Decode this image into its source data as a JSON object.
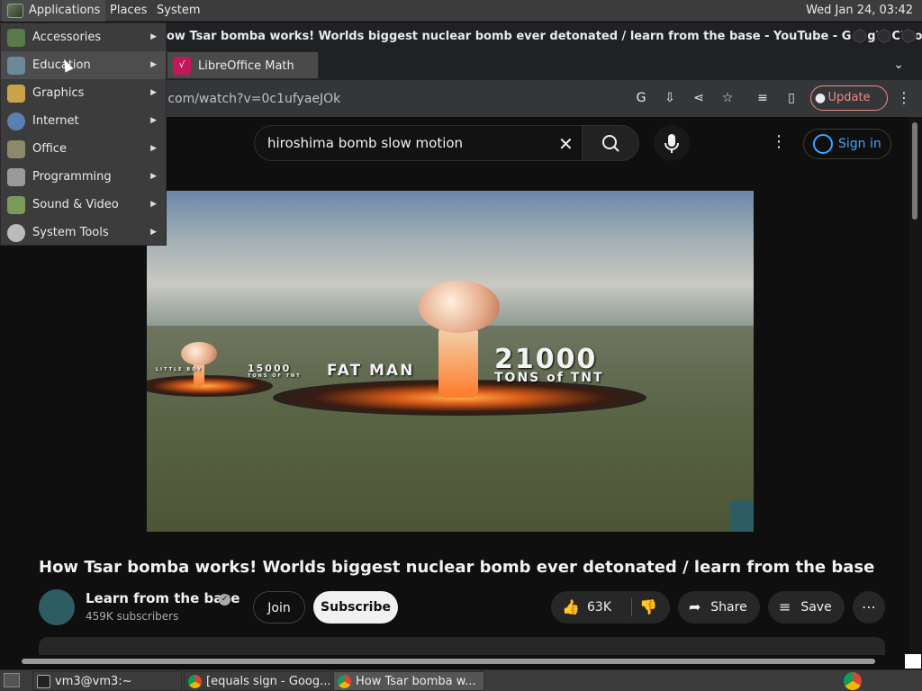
{
  "top_panel": {
    "applications": "Applications",
    "places": "Places",
    "system": "System",
    "clock": "Wed Jan 24, 03:42"
  },
  "apps_menu": {
    "items": [
      {
        "label": "Accessories",
        "icon": "accessories-icon"
      },
      {
        "label": "Education",
        "icon": "education-icon"
      },
      {
        "label": "Graphics",
        "icon": "graphics-icon"
      },
      {
        "label": "Internet",
        "icon": "internet-icon"
      },
      {
        "label": "Office",
        "icon": "office-icon"
      },
      {
        "label": "Programming",
        "icon": "programming-icon"
      },
      {
        "label": "Sound & Video",
        "icon": "sound-video-icon"
      },
      {
        "label": "System Tools",
        "icon": "system-tools-icon"
      }
    ],
    "active_index": 1,
    "submenu_item": "LibreOffice Math"
  },
  "chrome": {
    "window_title": "ow Tsar bomba works! Worlds biggest nuclear bomb ever detonated / learn from the base - YouTube - Google Chrome",
    "url": "tube.com/watch?v=0c1ufyaeJOk",
    "update_label": "Update"
  },
  "youtube": {
    "search_value": "hiroshima bomb slow motion",
    "signin_label": "Sign in",
    "video_overlay": {
      "left_label": "15000",
      "left_sub": "TONS OF TNT",
      "tiny_label": "LITTLE BOY",
      "center_label": "FAT MAN",
      "right_number": "21000",
      "right_sub": "TONS of TNT"
    },
    "video_title": "How Tsar bomba works! Worlds biggest nuclear bomb ever detonated / learn from the base",
    "channel_name": "Learn from the base",
    "subscribers": "459K subscribers",
    "join_label": "Join",
    "subscribe_label": "Subscribe",
    "like_count": "63K",
    "share_label": "Share",
    "save_label": "Save"
  },
  "taskbar": {
    "tasks": [
      {
        "label": "vm3@vm3:~",
        "icon": "terminal-icon"
      },
      {
        "label": "[equals sign - Goog...",
        "icon": "chrome-icon"
      },
      {
        "label": "How Tsar bomba w...",
        "icon": "chrome-icon"
      }
    ]
  },
  "colors": {
    "panel_bg": "#3c3c3c",
    "yt_bg": "#0f0f0f",
    "signin_blue": "#3ea6ff",
    "update_red": "#f28b82"
  }
}
